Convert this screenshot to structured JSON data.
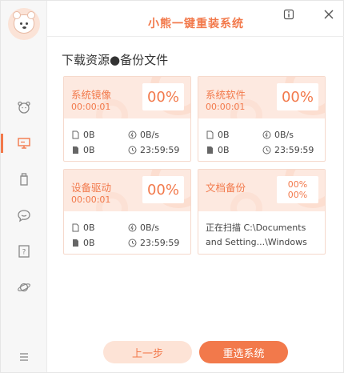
{
  "app": {
    "title": "小熊一键重装系统"
  },
  "sidebar": {
    "items": [
      {
        "name": "bear-icon"
      },
      {
        "name": "monitor-icon",
        "active": true
      },
      {
        "name": "usb-drive-icon"
      },
      {
        "name": "chat-icon"
      },
      {
        "name": "help-icon"
      },
      {
        "name": "planet-icon"
      }
    ],
    "menu_icon": "menu-icon"
  },
  "header": {
    "info_icon": "info-icon",
    "close_icon": "close-icon"
  },
  "section": {
    "title": "下载资源●备份文件"
  },
  "cards": [
    {
      "name": "系统镜像",
      "time": "00:00:01",
      "percent": "00%",
      "size": "0B",
      "speed": "0B/s",
      "size2": "0B",
      "remaining": "23:59:59"
    },
    {
      "name": "系统软件",
      "time": "00:00:01",
      "percent": "00%",
      "size": "0B",
      "speed": "0B/s",
      "size2": "0B",
      "remaining": "23:59:59"
    },
    {
      "name": "设备驱动",
      "time": "00:00:01",
      "percent": "00%",
      "size": "0B",
      "speed": "0B/s",
      "size2": "0B",
      "remaining": "23:59:59"
    },
    {
      "name": "文档备份",
      "percent_a": "00%",
      "percent_b": "00%",
      "scan_line1": "正在扫描 C:\\Documents",
      "scan_line2": "and Setting...\\Windows"
    }
  ],
  "footer": {
    "prev_label": "上一步",
    "next_label": "重选系统"
  },
  "colors": {
    "accent": "#f2794b",
    "accent_light": "#fde9e0"
  }
}
